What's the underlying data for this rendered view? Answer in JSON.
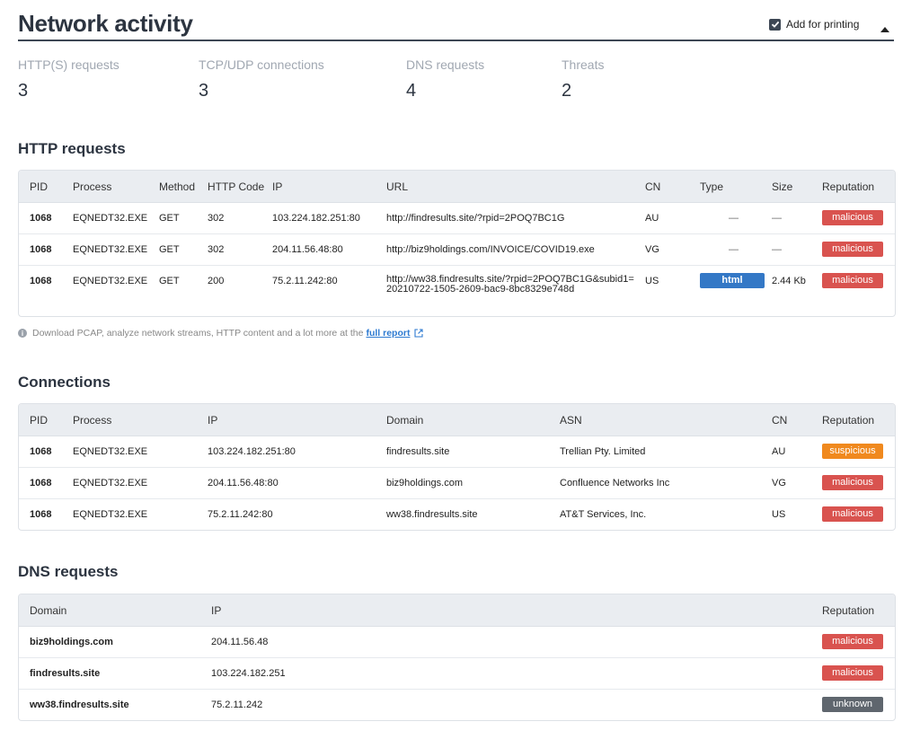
{
  "header": {
    "title": "Network activity",
    "print_label": "Add for printing"
  },
  "stats": [
    {
      "label": "HTTP(S) requests",
      "value": "3"
    },
    {
      "label": "TCP/UDP connections",
      "value": "3"
    },
    {
      "label": "DNS requests",
      "value": "4"
    },
    {
      "label": "Threats",
      "value": "2"
    }
  ],
  "http": {
    "title": "HTTP requests",
    "columns": [
      "PID",
      "Process",
      "Method",
      "HTTP Code",
      "IP",
      "URL",
      "CN",
      "Type",
      "Size",
      "Reputation"
    ],
    "rows": [
      {
        "pid": "1068",
        "process": "EQNEDT32.EXE",
        "method": "GET",
        "code": "302",
        "ip": "103.224.182.251:80",
        "url": "http://findresults.site/?rpid=2POQ7BC1G",
        "cn": "AU",
        "type": "—",
        "size": "—",
        "reputation": "malicious"
      },
      {
        "pid": "1068",
        "process": "EQNEDT32.EXE",
        "method": "GET",
        "code": "302",
        "ip": "204.11.56.48:80",
        "url": "http://biz9holdings.com/INVOICE/COVID19.exe",
        "cn": "VG",
        "type": "—",
        "size": "—",
        "reputation": "malicious"
      },
      {
        "pid": "1068",
        "process": "EQNEDT32.EXE",
        "method": "GET",
        "code": "200",
        "ip": "75.2.11.242:80",
        "url": "http://ww38.findresults.site/?rpid=2POQ7BC1G&subid1=20210722-1505-2609-bac9-8bc8329e748d",
        "cn": "US",
        "type": "html",
        "size": "2.44 Kb",
        "reputation": "malicious"
      }
    ]
  },
  "note": {
    "text": "Download PCAP, analyze network streams, HTTP content and a lot more at the",
    "link": "full report"
  },
  "connections": {
    "title": "Connections",
    "columns": [
      "PID",
      "Process",
      "IP",
      "Domain",
      "ASN",
      "CN",
      "Reputation"
    ],
    "rows": [
      {
        "pid": "1068",
        "process": "EQNEDT32.EXE",
        "ip": "103.224.182.251:80",
        "domain": "findresults.site",
        "asn": "Trellian Pty. Limited",
        "cn": "AU",
        "reputation": "suspicious"
      },
      {
        "pid": "1068",
        "process": "EQNEDT32.EXE",
        "ip": "204.11.56.48:80",
        "domain": "biz9holdings.com",
        "asn": "Confluence Networks Inc",
        "cn": "VG",
        "reputation": "malicious"
      },
      {
        "pid": "1068",
        "process": "EQNEDT32.EXE",
        "ip": "75.2.11.242:80",
        "domain": "ww38.findresults.site",
        "asn": "AT&T Services, Inc.",
        "cn": "US",
        "reputation": "malicious"
      }
    ]
  },
  "dns": {
    "title": "DNS requests",
    "columns": [
      "Domain",
      "IP",
      "Reputation"
    ],
    "rows": [
      {
        "domain": "biz9holdings.com",
        "ip": "204.11.56.48",
        "reputation": "malicious"
      },
      {
        "domain": "findresults.site",
        "ip": "103.224.182.251",
        "reputation": "malicious"
      },
      {
        "domain": "ww38.findresults.site",
        "ip": "75.2.11.242",
        "reputation": "unknown"
      }
    ]
  },
  "colors": {
    "malicious": "#d9534f",
    "suspicious": "#f0891e",
    "unknown": "#5f666e",
    "html_type": "#3478c6"
  },
  "icons": [
    "check-icon",
    "caret-up-icon",
    "info-icon",
    "external-link-icon"
  ]
}
